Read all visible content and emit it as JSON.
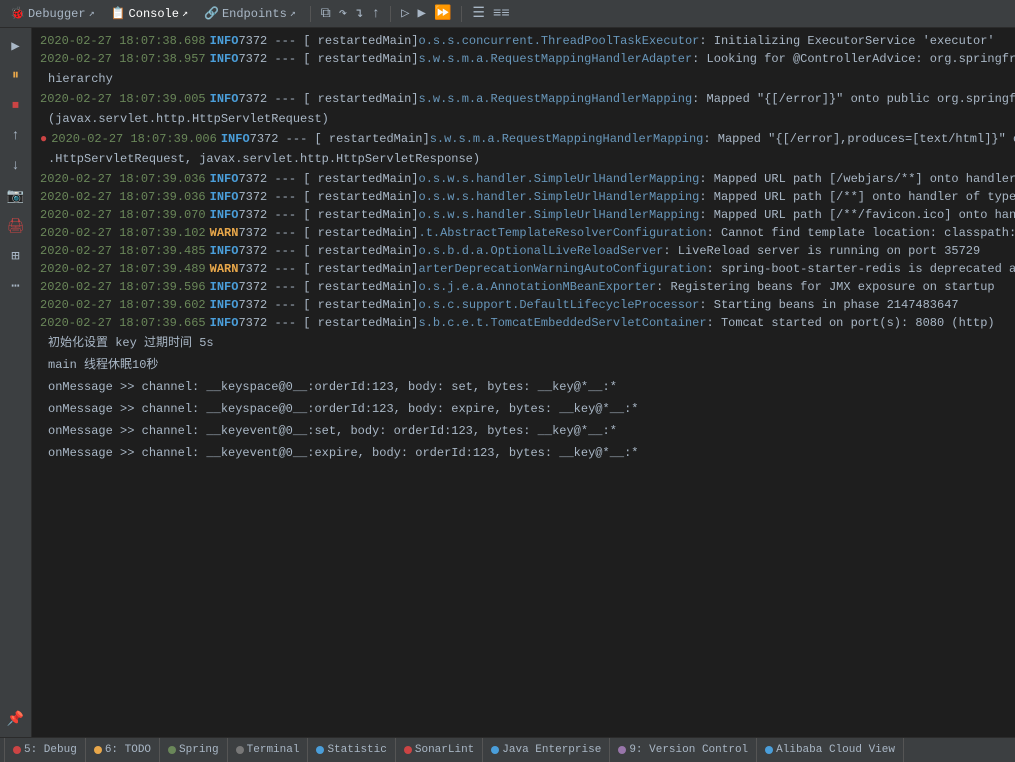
{
  "toolbar": {
    "items": [
      {
        "label": "Debugger",
        "active": false,
        "icon": "🐞"
      },
      {
        "label": "Console",
        "active": true,
        "icon": "📋"
      },
      {
        "label": "Endpoints",
        "active": false,
        "icon": "🔗"
      }
    ],
    "controls": [
      "▶",
      "⏸",
      "⏹",
      "↑",
      "↓",
      "↓",
      "↑",
      "⟳",
      "▷",
      "▷▷",
      "⏩",
      "≡",
      "≡≡"
    ]
  },
  "sidebar_icons": [
    {
      "name": "play",
      "symbol": "▶",
      "active": false
    },
    {
      "name": "pause",
      "symbol": "⏸",
      "active": true,
      "color": "orange"
    },
    {
      "name": "stop",
      "symbol": "⏹",
      "active": false,
      "color": "red"
    },
    {
      "name": "step-over",
      "symbol": "↷",
      "active": false
    },
    {
      "name": "camera",
      "symbol": "📷",
      "active": false
    },
    {
      "name": "printer",
      "symbol": "🖨",
      "active": false,
      "color": "red"
    },
    {
      "name": "grid",
      "symbol": "⊞",
      "active": false
    },
    {
      "name": "dots",
      "symbol": "⋯",
      "active": false
    },
    {
      "name": "pin",
      "symbol": "📌",
      "active": false
    }
  ],
  "logs": [
    {
      "timestamp": "2020-02-27 18:07:38.698",
      "level": "INFO",
      "pid": "7372",
      "thread": "restartedMain",
      "logger": "o.s.s.concurrent.ThreadPoolTaskExecutor",
      "message": ": Initializing ExecutorService 'executor'"
    },
    {
      "timestamp": "2020-02-27 18:07:38.957",
      "level": "INFO",
      "pid": "7372",
      "thread": "restartedMain",
      "logger": "s.w.s.m.a.RequestMappingHandlerAdapter",
      "message": ": Looking for @ControllerAdvice: org.springframework.boot.co"
    },
    {
      "type": "continuation",
      "text": "hierarchy"
    },
    {
      "timestamp": "2020-02-27 18:07:39.005",
      "level": "INFO",
      "pid": "7372",
      "thread": "restartedMain",
      "logger": "s.w.s.m.a.RequestMappingHandlerMapping",
      "message": ": Mapped \"{[/error]}\" onto public org.springframework.http.R"
    },
    {
      "type": "continuation",
      "text": "(javax.servlet.http.HttpServletRequest)"
    },
    {
      "timestamp": "2020-02-27 18:07:39.006",
      "level": "INFO",
      "pid": "7372",
      "thread": "restartedMain",
      "logger": "s.w.s.m.a.RequestMappingHandlerMapping",
      "message": ": Mapped \"{[/error],produces=[text/html]}\" onto public org.s",
      "hasDot": true
    },
    {
      "type": "continuation",
      "text": ".HttpServletRequest, javax.servlet.http.HttpServletResponse)"
    },
    {
      "timestamp": "2020-02-27 18:07:39.036",
      "level": "INFO",
      "pid": "7372",
      "thread": "restartedMain",
      "logger": "o.s.w.s.handler.SimpleUrlHandlerMapping",
      "message": ": Mapped URL path [/webjars/**] onto handler of type [class"
    },
    {
      "timestamp": "2020-02-27 18:07:39.036",
      "level": "INFO",
      "pid": "7372",
      "thread": "restartedMain",
      "logger": "o.s.w.s.handler.SimpleUrlHandlerMapping",
      "message": ": Mapped URL path [/**] onto handler of type [class org.spri"
    },
    {
      "timestamp": "2020-02-27 18:07:39.070",
      "level": "INFO",
      "pid": "7372",
      "thread": "restartedMain",
      "logger": "o.s.w.s.handler.SimpleUrlHandlerMapping",
      "message": ": Mapped URL path [/**/favicon.ico] onto handler of type [cl"
    },
    {
      "timestamp": "2020-02-27 18:07:39.102",
      "level": "WARN",
      "pid": "7372",
      "thread": "restartedMain",
      "logger": ".t.AbstractTemplateResolverConfiguration",
      "message": ": Cannot find template location: classpath:/templates/ (plea"
    },
    {
      "timestamp": "2020-02-27 18:07:39.485",
      "level": "INFO",
      "pid": "7372",
      "thread": "restartedMain",
      "logger": "o.s.b.d.a.OptionalLiveReloadServer",
      "message": ": LiveReload server is running on port 35729"
    },
    {
      "timestamp": "2020-02-27 18:07:39.489",
      "level": "WARN",
      "pid": "7372",
      "thread": "restartedMain",
      "logger": "arterDeprecationWarningAutoConfiguration",
      "message": ": spring-boot-starter-redis is deprecated as of Spring Boot"
    },
    {
      "timestamp": "2020-02-27 18:07:39.596",
      "level": "INFO",
      "pid": "7372",
      "thread": "restartedMain",
      "logger": "o.s.j.e.a.AnnotationMBeanExporter",
      "message": ": Registering beans for JMX exposure on startup"
    },
    {
      "timestamp": "2020-02-27 18:07:39.602",
      "level": "INFO",
      "pid": "7372",
      "thread": "restartedMain",
      "logger": "o.s.c.support.DefaultLifecycleProcessor",
      "message": ": Starting beans in phase 2147483647"
    },
    {
      "timestamp": "2020-02-27 18:07:39.665",
      "level": "INFO",
      "pid": "7372",
      "thread": "restartedMain",
      "logger": "s.b.c.e.t.TomcatEmbeddedServletContainer",
      "message": ": Tomcat started on port(s): 8080 (http)"
    }
  ],
  "plain_messages": [
    "初始化设置 key 过期时间 5s",
    "main 线程休眠10秒",
    "onMessage >> channel: __keyspace@0__:orderId:123, body: set, bytes: __key@*__:*",
    "onMessage >> channel: __keyspace@0__:orderId:123, body: expire, bytes: __key@*__:*",
    "onMessage >> channel: __keyevent@0__:set, body: orderId:123, bytes: __key@*__:*",
    "onMessage >> channel: __keyevent@0__:expire, body: orderId:123, bytes: __key@*__:*"
  ],
  "status_bar": {
    "items": [
      {
        "label": "5: Debug",
        "dot_color": "red",
        "icon": "🐞"
      },
      {
        "label": "6: TODO",
        "dot_color": "orange",
        "icon": "✓"
      },
      {
        "label": "Spring",
        "dot_color": "green",
        "icon": "🍃"
      },
      {
        "label": "Terminal",
        "dot_color": "gray",
        "icon": "▶"
      },
      {
        "label": "Statistic",
        "dot_color": "blue",
        "icon": "📊"
      },
      {
        "label": "SonarLint",
        "dot_color": "red",
        "icon": "🔴"
      },
      {
        "label": "Java Enterprise",
        "dot_color": "blue",
        "icon": "☕"
      },
      {
        "label": "9: Version Control",
        "dot_color": "purple",
        "icon": "🔀"
      },
      {
        "label": "Alibaba Cloud View",
        "dot_color": "blue",
        "icon": "☁"
      }
    ]
  }
}
